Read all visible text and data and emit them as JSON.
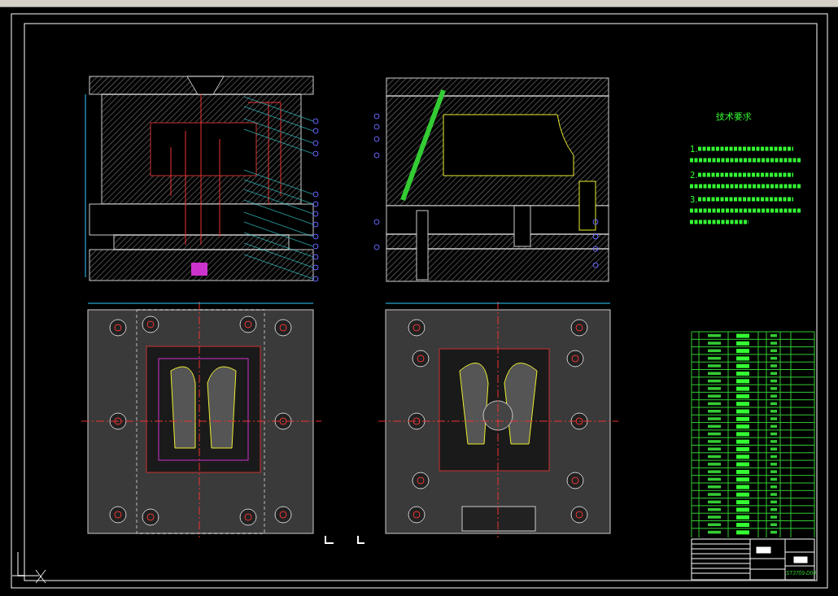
{
  "technical_requirements": {
    "heading": "技术要求",
    "items": [
      {
        "number": "1."
      },
      {
        "number": "2."
      },
      {
        "number": "3."
      }
    ]
  },
  "title_block": {
    "drawing_number": "ST3709-D00"
  }
}
